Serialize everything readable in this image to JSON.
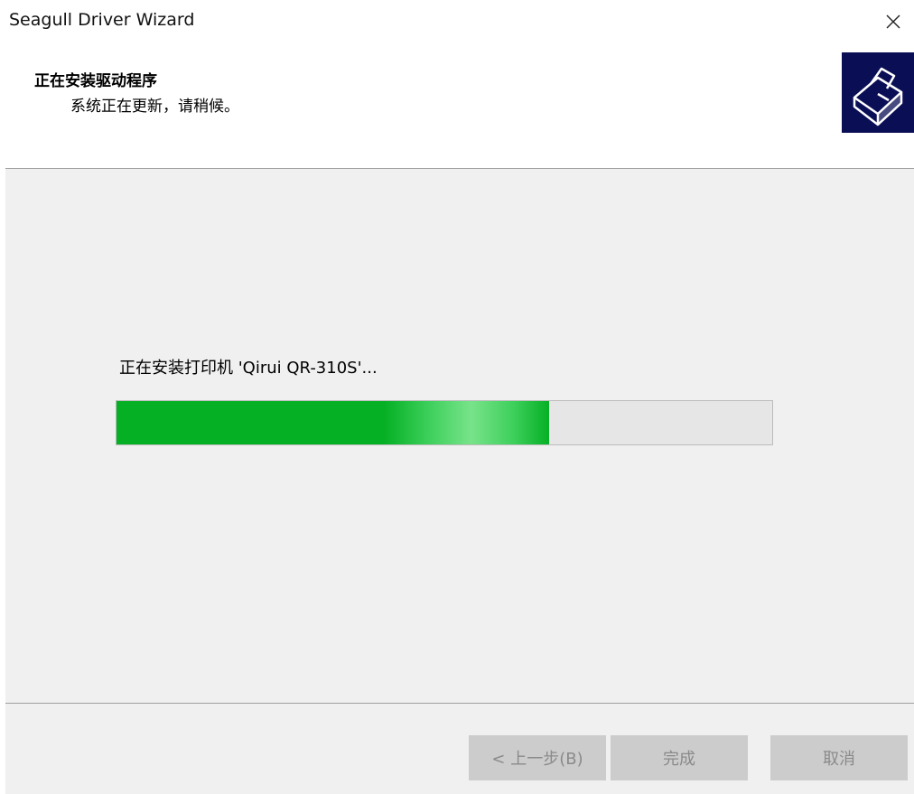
{
  "window": {
    "title": "Seagull Driver Wizard"
  },
  "header": {
    "title": "正在安装驱动程序",
    "subtitle": "系统正在更新，请稍候。"
  },
  "content": {
    "status": "正在安装打印机 'Qirui QR-310S'...",
    "progress_percent": 66
  },
  "footer": {
    "back_label": "< 上一步(B)",
    "finish_label": "完成",
    "cancel_label": "取消"
  },
  "colors": {
    "progress_fill": "#06b025",
    "logo_bg": "#0a0f55",
    "panel_bg": "#f0f0f0",
    "disabled_button": "#cccccc"
  },
  "icons": {
    "close": "close-icon",
    "logo": "printer-logo-icon"
  }
}
